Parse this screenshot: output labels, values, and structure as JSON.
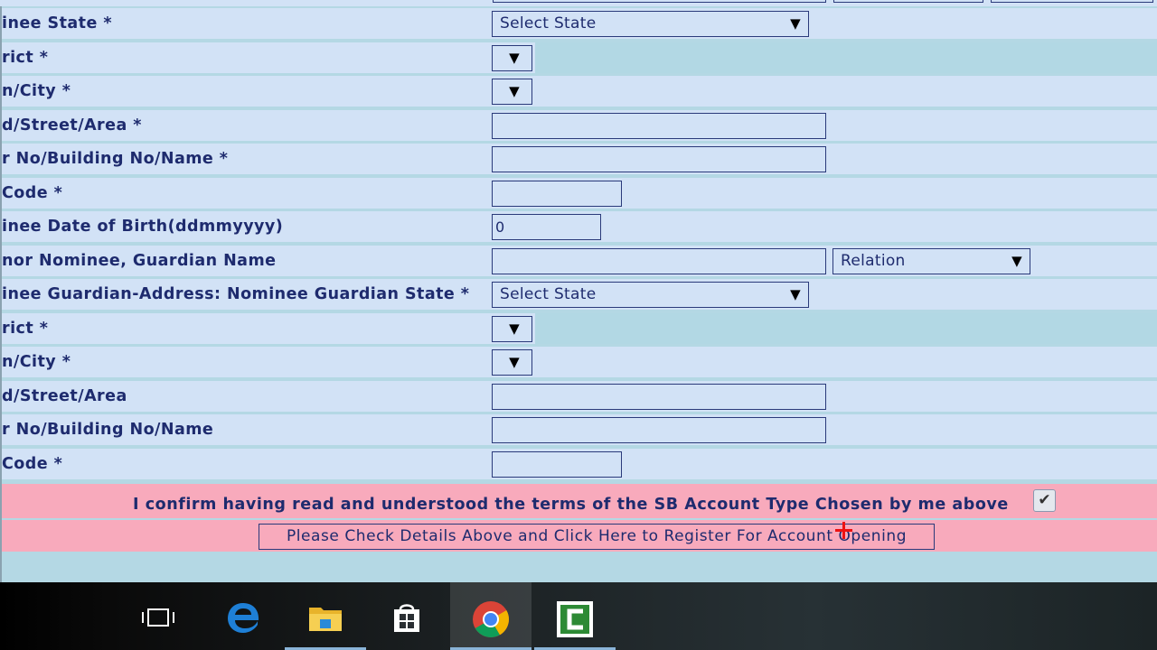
{
  "form": {
    "rows": [
      {
        "label": "inee State *",
        "control": "Select State"
      },
      {
        "label": "rict *"
      },
      {
        "label": "n/City *"
      },
      {
        "label": "d/Street/Area *"
      },
      {
        "label": "r No/Building No/Name *"
      },
      {
        "label": "Code *"
      },
      {
        "label": "inee Date of Birth(ddmmyyyy)",
        "value": "0"
      },
      {
        "label": "nor Nominee, Guardian Name",
        "extra": "Relation"
      },
      {
        "label": "inee Guardian-Address: Nominee Guardian State *",
        "control": "Select State"
      },
      {
        "label": "rict *"
      },
      {
        "label": "n/City *"
      },
      {
        "label": "d/Street/Area"
      },
      {
        "label": "r No/Building No/Name"
      },
      {
        "label": "Code *"
      }
    ],
    "confirm_text": "I confirm having read and understood the terms of the SB Account Type Chosen by me above",
    "confirm_checked": true,
    "register_button": "Please Check Details Above and Click Here to Register For Account Opening",
    "dropdown_arrow": "▼",
    "check_mark": "✔"
  },
  "taskbar": {
    "items": [
      {
        "name": "task-view-icon"
      },
      {
        "name": "edge-icon"
      },
      {
        "name": "file-explorer-icon"
      },
      {
        "name": "store-icon"
      },
      {
        "name": "chrome-icon"
      },
      {
        "name": "camtasia-icon"
      }
    ]
  },
  "colors": {
    "row_bg": "#d2e2f6",
    "alt_bg": "#b4d8e4",
    "label_text": "#1e2b6e",
    "confirm_bg": "#f8aabc",
    "cursor": "#e11111"
  }
}
